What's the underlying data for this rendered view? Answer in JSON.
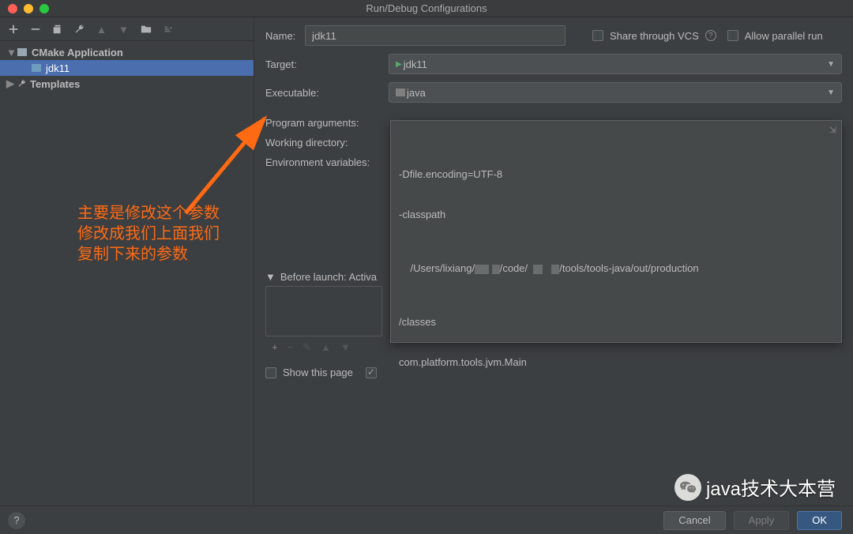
{
  "window": {
    "title": "Run/Debug Configurations"
  },
  "tree": {
    "cmake_label": "CMake Application",
    "jdk11": "jdk11",
    "templates": "Templates"
  },
  "form": {
    "name_label": "Name:",
    "name_value": "jdk11",
    "share_label": "Share through VCS",
    "allow_parallel": "Allow parallel run",
    "target_label": "Target:",
    "target_value": "jdk11",
    "exec_label": "Executable:",
    "exec_value": "java",
    "progargs_label": "Program arguments:",
    "workdir_label": "Working directory:",
    "envvars_label": "Environment variables:",
    "args_line1": "-Dfile.encoding=UTF-8",
    "args_line2": "-classpath",
    "args_path_a": "/Users/lixiang/",
    "args_path_b": "/code/",
    "args_path_c": "/tools/tools-java/out/production",
    "args_line4": "/classes",
    "args_line5": "com.platform.tools.jvm.Main",
    "before_launch": "Before launch: Activa",
    "show_this_page": "Show this page"
  },
  "buttons": {
    "cancel": "Cancel",
    "apply": "Apply",
    "ok": "OK"
  },
  "annotation": {
    "l1": "主要是修改这个参数",
    "l2": "修改成我们上面我们",
    "l3": "复制下来的参数"
  },
  "watermark": "java技术大本营"
}
